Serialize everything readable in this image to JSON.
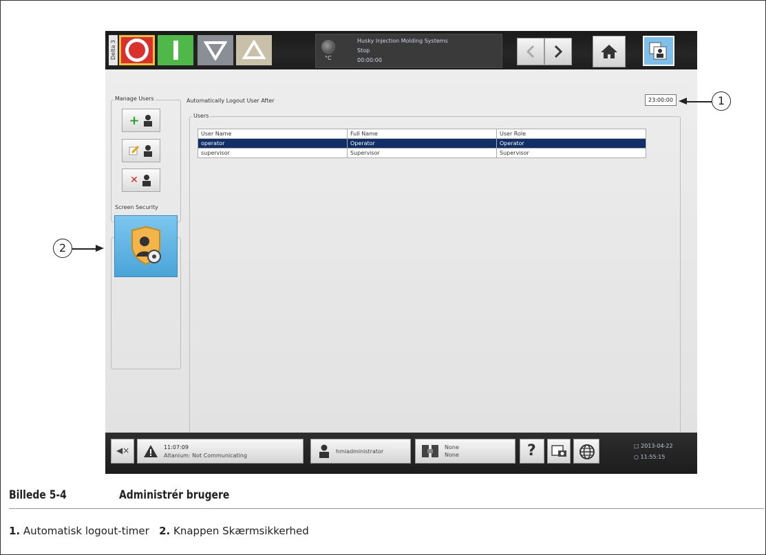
{
  "figure": {
    "number": "Billede 5-4",
    "title": "Administrér brugere",
    "legend": [
      {
        "num": "1.",
        "text": "Automatisk logout-timer"
      },
      {
        "num": "2.",
        "text": "Knappen Skærmsikkerhed"
      }
    ],
    "callouts": [
      "1",
      "2"
    ]
  },
  "hmi": {
    "side_tab": "Delta 3",
    "status": {
      "line1": "Husky Injection Molding Systems",
      "line2": "Stop",
      "line3": "00:00:00",
      "unit": "°C"
    },
    "manage_users_label": "Manage Users",
    "screen_security_label": "Screen Security",
    "logout_label": "Automatically Logout User After",
    "logout_value": "23:00:00",
    "users_group_label": "Users",
    "table": {
      "columns": [
        "User Name",
        "Full Name",
        "User Role"
      ],
      "rows": [
        [
          "operator",
          "Operator",
          "Operator"
        ],
        [
          "supervisor",
          "Supervisor",
          "Supervisor"
        ]
      ],
      "selected_row": 0
    },
    "bottom": {
      "alarm_time": "11:07:09",
      "alarm_text": "Altanium: Not Communicating",
      "user": "hmiadministrator",
      "mold_line1": "None",
      "mold_line2": "None",
      "help": "?",
      "date": "2013-04-22",
      "time": "11:55:15"
    }
  }
}
